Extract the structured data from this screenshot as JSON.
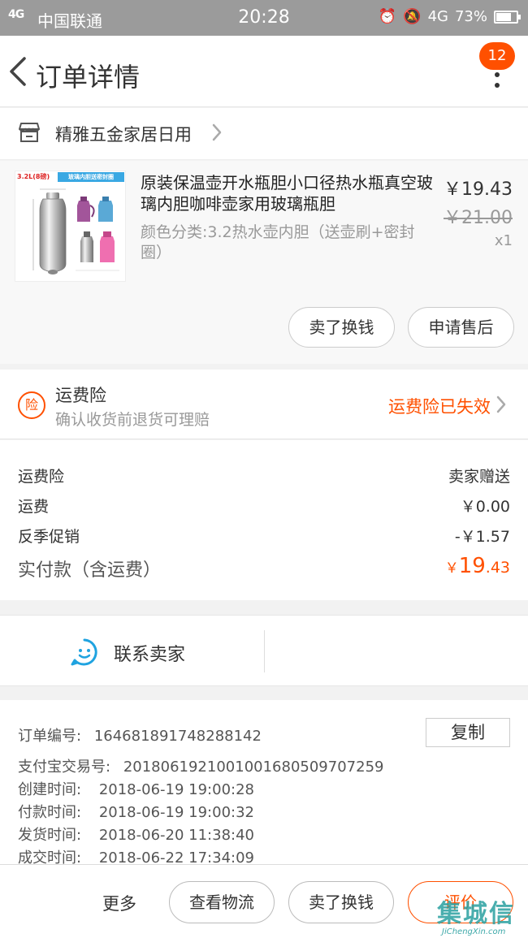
{
  "status_bar": {
    "signal": "4G",
    "carrier": "中国联通",
    "time": "20:28",
    "network": "4G",
    "battery": "73%",
    "battery_level": 0.73
  },
  "header": {
    "title": "订单详情",
    "badge_count": "12"
  },
  "shop": {
    "name": "精雅五金家居日用"
  },
  "product": {
    "image_tag": "3.2L(8磅)",
    "image_banner": "玻璃内胆送密封圈",
    "title": "原装保温壶开水瓶胆小口径热水瓶真空玻璃内胆咖啡壶家用玻璃瓶胆",
    "sku": "颜色分类:3.2热水壶内胆（送壶刷+密封圈）",
    "price": "￥19.43",
    "original_price": "￥21.00",
    "quantity": "x1",
    "buttons": {
      "sell": "卖了换钱",
      "after_sale": "申请售后"
    }
  },
  "insurance": {
    "icon_text": "险",
    "title": "运费险",
    "subtitle": "确认收货前退货可理赔",
    "status": "运费险已失效"
  },
  "fees": [
    {
      "label": "运费险",
      "value": "卖家赠送"
    },
    {
      "label": "运费",
      "value": "￥0.00"
    },
    {
      "label": "反季促销",
      "value": "-￥1.57"
    }
  ],
  "total": {
    "label": "实付款（含运费）",
    "currency": "￥",
    "integer": "19",
    "decimal": ".43"
  },
  "contact": {
    "label": "联系卖家"
  },
  "order_info": {
    "order_no_label": "订单编号:",
    "order_no": "164681891748288142",
    "copy_label": "复制",
    "alipay_label": "支付宝交易号:",
    "alipay_no": "2018061921001001680509707259",
    "created_label": "创建时间:",
    "created": "2018-06-19 19:00:28",
    "paid_label": "付款时间:",
    "paid": "2018-06-19 19:00:32",
    "shipped_label": "发货时间:",
    "shipped": "2018-06-20 11:38:40",
    "completed_label": "成交时间:",
    "completed": "2018-06-22 17:34:09"
  },
  "bottom_bar": {
    "more": "更多",
    "logistics": "查看物流",
    "sell": "卖了换钱",
    "review": "评价"
  },
  "watermark": {
    "text": "集城信",
    "url": "JiChengXin.com"
  },
  "colors": {
    "accent": "#ff5000",
    "status_bar": "#9b9b9b",
    "contact_icon": "#1fa3e0"
  }
}
